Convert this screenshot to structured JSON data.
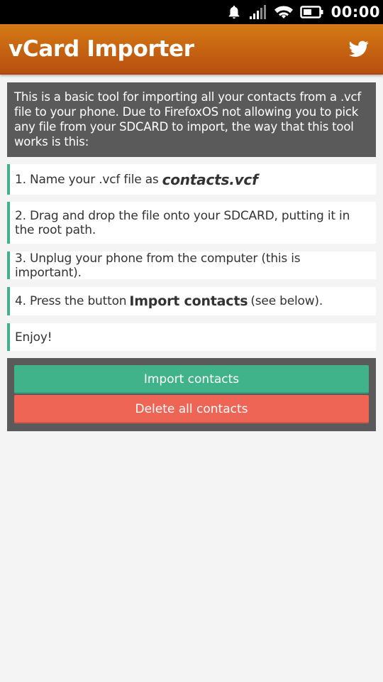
{
  "status_bar": {
    "time": "00:00",
    "icons": [
      "notification-bell-icon",
      "signal-icon",
      "wifi-icon",
      "battery-icon"
    ]
  },
  "header": {
    "title": "vCard Importer",
    "share_icon": "twitter-icon"
  },
  "intro": "This is a basic tool for importing all your contacts from a .vcf file to your phone. Due to FirefoxOS not allowing you to pick any file from your SDCARD to import, the way that this tool works is this:",
  "steps": {
    "s1_prefix": "1. Name your .vcf file as",
    "s1_file": "contacts.vcf",
    "s2": "2. Drag and drop the file onto your SDCARD, putting it in the root path.",
    "s3": "3. Unplug your phone from the computer (this is important).",
    "s4_prefix": "4. Press the button",
    "s4_button": "Import contacts",
    "s4_suffix": "(see below).",
    "s5": "Enjoy!"
  },
  "buttons": {
    "import_label": "Import contacts",
    "delete_label": "Delete all contacts"
  },
  "colors": {
    "header": "#c8661a",
    "accent_green": "#40b38a",
    "danger_red": "#ee6455",
    "panel_gray": "#5a5a5a"
  }
}
